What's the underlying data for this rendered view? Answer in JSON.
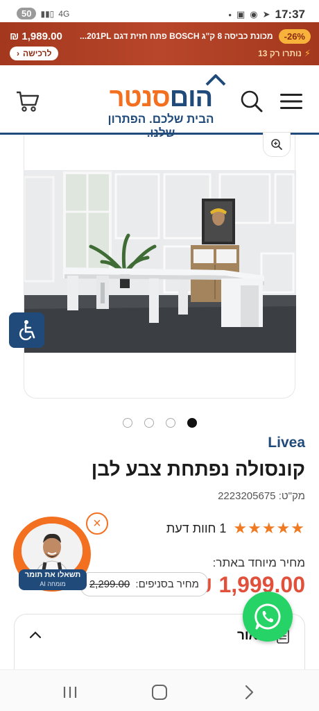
{
  "status_bar": {
    "badge": "50",
    "network": "4G",
    "time": "17:37"
  },
  "promo": {
    "discount": "-26%",
    "title": "מכונת כביסה 8 ק\"ג BOSCH פתח חזית דגם 201PL...",
    "price": "₪ 1,989.00",
    "stock": "נותרו רק 13",
    "buy_label": "לרכישה"
  },
  "header": {
    "logo_orange": "סנטר",
    "logo_blue": "הום",
    "tagline": "הבית שלכם. הפתרון שלנו."
  },
  "gallery": {
    "dots": 4,
    "active_dot": 1
  },
  "product": {
    "brand": "Livea",
    "title": "קונסולה נפתחת צבע לבן",
    "sku": "מק\"ט: 2223205675",
    "rating": 5,
    "stars": "★★★★★",
    "reviews": "1 חוות דעת",
    "special_label": "מחיר מיוחד באתר:",
    "price": "₪ 1,999.00",
    "store_price_label": "מחיר בסניפים:",
    "store_price": "2,299.00"
  },
  "description": {
    "title": "תיאור"
  },
  "assistant": {
    "label": "תשאלו את תומר",
    "sub": "מומחה AI"
  },
  "colors": {
    "brand_orange": "#f37021",
    "brand_blue": "#1f4a7a",
    "price_red": "#e0503a",
    "whatsapp_green": "#25d366"
  }
}
